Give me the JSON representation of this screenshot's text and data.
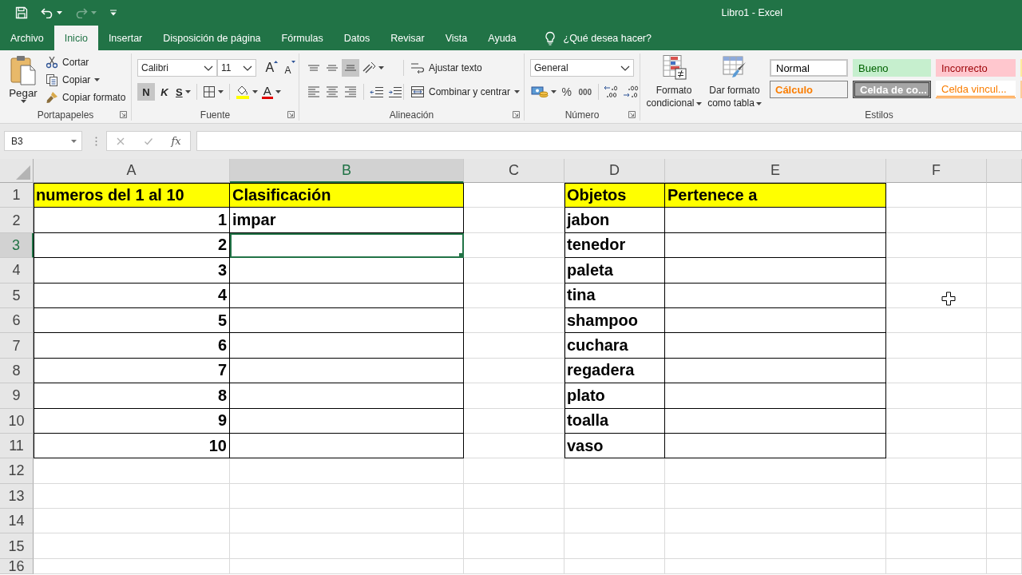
{
  "title_bar": {
    "title": "Libro1 - Excel",
    "quick_access": [
      {
        "kind": "save",
        "disabled": false
      },
      {
        "kind": "undo",
        "disabled": false
      },
      {
        "kind": "redo",
        "disabled": true
      },
      {
        "kind": "customize",
        "disabled": false
      }
    ]
  },
  "ribbon_tabs": [
    {
      "label": "Archivo",
      "selected": false
    },
    {
      "label": "Inicio",
      "selected": true
    },
    {
      "label": "Insertar",
      "selected": false
    },
    {
      "label": "Disposición de página",
      "selected": false
    },
    {
      "label": "Fórmulas",
      "selected": false
    },
    {
      "label": "Datos",
      "selected": false
    },
    {
      "label": "Revisar",
      "selected": false
    },
    {
      "label": "Vista",
      "selected": false
    },
    {
      "label": "Ayuda",
      "selected": false
    }
  ],
  "tell_me": {
    "placeholder": "¿Qué desea hacer?"
  },
  "ribbon": {
    "clipboard": {
      "paste": "Pegar",
      "cut": "Cortar",
      "copy": "Copiar",
      "format_painter": "Copiar formato",
      "label": "Portapapeles"
    },
    "font": {
      "font_name": "Calibri",
      "font_size": "11",
      "grow_font": "A",
      "shrink_font": "A",
      "format_buttons": [
        {
          "kind": "bold",
          "label": "N",
          "selected": true
        },
        {
          "kind": "italic",
          "label": "K",
          "selected": false
        },
        {
          "kind": "underline",
          "label": "S",
          "selected": false
        }
      ],
      "font_color": "A",
      "label": "Fuente"
    },
    "alignment": {
      "vertical": [
        {
          "kind": "top",
          "selected": false
        },
        {
          "kind": "middle",
          "selected": false
        },
        {
          "kind": "bottom",
          "selected": true
        }
      ],
      "wrap_text": "Ajustar texto",
      "horizontal": [
        {
          "kind": "left",
          "selected": false
        },
        {
          "kind": "center",
          "selected": false
        },
        {
          "kind": "right",
          "selected": false
        }
      ],
      "merge": "Combinar y centrar",
      "label": "Alineación"
    },
    "number": {
      "format": "General",
      "percent": "%",
      "thousands": "000",
      "label": "Número"
    },
    "styles": {
      "conditional_format": "Formato condicional",
      "format_as_table": "Dar formato como tabla",
      "gallery": [
        {
          "kind": "normal",
          "label": "Normal",
          "selected": true
        },
        {
          "kind": "good",
          "label": "Bueno",
          "selected": false
        },
        {
          "kind": "bad",
          "label": "Incorrecto",
          "selected": false
        },
        {
          "kind": "neutral",
          "selected": false
        },
        {
          "kind": "calculation",
          "label": "Cálculo",
          "selected": false
        },
        {
          "kind": "check",
          "label": "Celda de co...",
          "selected": false
        },
        {
          "kind": "linked",
          "label": "Celda vincul...",
          "selected": false
        },
        {
          "kind": "input",
          "selected": false
        }
      ],
      "label": "Estilos"
    }
  },
  "formula_bar": {
    "name_box": "B3",
    "function_button": "fx"
  },
  "sheet": {
    "columns": [
      {
        "label": "A",
        "selected": false
      },
      {
        "label": "B",
        "selected": true
      },
      {
        "label": "C",
        "selected": false
      },
      {
        "label": "D",
        "selected": false
      },
      {
        "label": "E",
        "selected": false
      },
      {
        "label": "F",
        "selected": false
      }
    ],
    "rows": [
      {
        "label": "1",
        "selected": false,
        "cells": [
          {
            "kind": "header",
            "text": "numeros del 1 al 10",
            "bordered": true,
            "selected": false
          },
          {
            "kind": "header",
            "text": "Clasificación",
            "bordered": true,
            "selected": false
          },
          {
            "kind": "empty",
            "bordered": false,
            "selected": false
          },
          {
            "kind": "header",
            "text": "Objetos",
            "bordered": true,
            "selected": false
          },
          {
            "kind": "header",
            "text": "Pertenece a",
            "bordered": true,
            "selected": false
          },
          {
            "kind": "empty",
            "bordered": false,
            "selected": false
          }
        ]
      },
      {
        "label": "2",
        "selected": false,
        "cells": [
          {
            "kind": "number",
            "text": "1",
            "bordered": true,
            "selected": false
          },
          {
            "kind": "text",
            "text": "impar",
            "bordered": true,
            "selected": false
          },
          {
            "kind": "empty",
            "bordered": false,
            "selected": false
          },
          {
            "kind": "text",
            "text": "jabon",
            "bordered": true,
            "selected": false
          },
          {
            "kind": "empty",
            "bordered": true,
            "selected": false
          },
          {
            "kind": "empty",
            "bordered": false,
            "selected": false
          }
        ]
      },
      {
        "label": "3",
        "selected": true,
        "cells": [
          {
            "kind": "number",
            "text": "2",
            "bordered": true,
            "selected": false
          },
          {
            "kind": "empty",
            "bordered": true,
            "selected": true
          },
          {
            "kind": "empty",
            "bordered": false,
            "selected": false
          },
          {
            "kind": "text",
            "text": "tenedor",
            "bordered": true,
            "selected": false
          },
          {
            "kind": "empty",
            "bordered": true,
            "selected": false
          },
          {
            "kind": "empty",
            "bordered": false,
            "selected": false
          }
        ]
      },
      {
        "label": "4",
        "selected": false,
        "cells": [
          {
            "kind": "number",
            "text": "3",
            "bordered": true,
            "selected": false
          },
          {
            "kind": "empty",
            "bordered": true,
            "selected": false
          },
          {
            "kind": "empty",
            "bordered": false,
            "selected": false
          },
          {
            "kind": "text",
            "text": "paleta",
            "bordered": true,
            "selected": false
          },
          {
            "kind": "empty",
            "bordered": true,
            "selected": false
          },
          {
            "kind": "empty",
            "bordered": false,
            "selected": false
          }
        ]
      },
      {
        "label": "5",
        "selected": false,
        "cells": [
          {
            "kind": "number",
            "text": "4",
            "bordered": true,
            "selected": false
          },
          {
            "kind": "empty",
            "bordered": true,
            "selected": false
          },
          {
            "kind": "empty",
            "bordered": false,
            "selected": false
          },
          {
            "kind": "text",
            "text": "tina",
            "bordered": true,
            "selected": false
          },
          {
            "kind": "empty",
            "bordered": true,
            "selected": false
          },
          {
            "kind": "empty",
            "bordered": false,
            "selected": false
          }
        ]
      },
      {
        "label": "6",
        "selected": false,
        "cells": [
          {
            "kind": "number",
            "text": "5",
            "bordered": true,
            "selected": false
          },
          {
            "kind": "empty",
            "bordered": true,
            "selected": false
          },
          {
            "kind": "empty",
            "bordered": false,
            "selected": false
          },
          {
            "kind": "text",
            "text": "shampoo",
            "bordered": true,
            "selected": false
          },
          {
            "kind": "empty",
            "bordered": true,
            "selected": false
          },
          {
            "kind": "empty",
            "bordered": false,
            "selected": false
          }
        ]
      },
      {
        "label": "7",
        "selected": false,
        "cells": [
          {
            "kind": "number",
            "text": "6",
            "bordered": true,
            "selected": false
          },
          {
            "kind": "empty",
            "bordered": true,
            "selected": false
          },
          {
            "kind": "empty",
            "bordered": false,
            "selected": false
          },
          {
            "kind": "text",
            "text": "cuchara",
            "bordered": true,
            "selected": false
          },
          {
            "kind": "empty",
            "bordered": true,
            "selected": false
          },
          {
            "kind": "empty",
            "bordered": false,
            "selected": false
          }
        ]
      },
      {
        "label": "8",
        "selected": false,
        "cells": [
          {
            "kind": "number",
            "text": "7",
            "bordered": true,
            "selected": false
          },
          {
            "kind": "empty",
            "bordered": true,
            "selected": false
          },
          {
            "kind": "empty",
            "bordered": false,
            "selected": false
          },
          {
            "kind": "text",
            "text": "regadera",
            "bordered": true,
            "selected": false
          },
          {
            "kind": "empty",
            "bordered": true,
            "selected": false
          },
          {
            "kind": "empty",
            "bordered": false,
            "selected": false
          }
        ]
      },
      {
        "label": "9",
        "selected": false,
        "cells": [
          {
            "kind": "number",
            "text": "8",
            "bordered": true,
            "selected": false
          },
          {
            "kind": "empty",
            "bordered": true,
            "selected": false
          },
          {
            "kind": "empty",
            "bordered": false,
            "selected": false
          },
          {
            "kind": "text",
            "text": "plato",
            "bordered": true,
            "selected": false
          },
          {
            "kind": "empty",
            "bordered": true,
            "selected": false
          },
          {
            "kind": "empty",
            "bordered": false,
            "selected": false
          }
        ]
      },
      {
        "label": "10",
        "selected": false,
        "cells": [
          {
            "kind": "number",
            "text": "9",
            "bordered": true,
            "selected": false
          },
          {
            "kind": "empty",
            "bordered": true,
            "selected": false
          },
          {
            "kind": "empty",
            "bordered": false,
            "selected": false
          },
          {
            "kind": "text",
            "text": "toalla",
            "bordered": true,
            "selected": false
          },
          {
            "kind": "empty",
            "bordered": true,
            "selected": false
          },
          {
            "kind": "empty",
            "bordered": false,
            "selected": false
          }
        ]
      },
      {
        "label": "11",
        "selected": false,
        "cells": [
          {
            "kind": "number",
            "text": "10",
            "bordered": true,
            "selected": false
          },
          {
            "kind": "empty",
            "bordered": true,
            "selected": false
          },
          {
            "kind": "empty",
            "bordered": false,
            "selected": false
          },
          {
            "kind": "text",
            "text": "vaso",
            "bordered": true,
            "selected": false
          },
          {
            "kind": "empty",
            "bordered": true,
            "selected": false
          },
          {
            "kind": "empty",
            "bordered": false,
            "selected": false
          }
        ]
      },
      {
        "label": "12",
        "selected": false
      },
      {
        "label": "13",
        "selected": false
      },
      {
        "label": "14",
        "selected": false
      },
      {
        "label": "15",
        "selected": false
      },
      {
        "label": "16",
        "selected": false
      }
    ]
  }
}
